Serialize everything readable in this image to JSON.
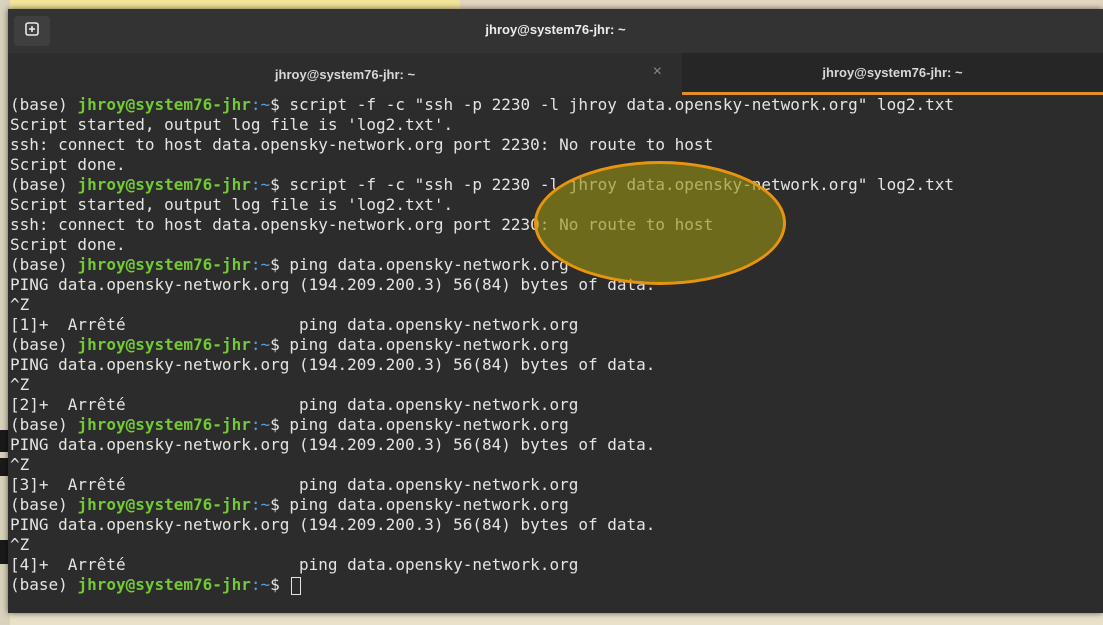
{
  "window": {
    "title": "jhroy@system76-jhr: ~"
  },
  "tabs": [
    {
      "label": "jhroy@system76-jhr: ~",
      "close": "×"
    },
    {
      "label": "jhroy@system76-jhr: ~"
    }
  ],
  "prompt": {
    "env": "(base) ",
    "user_host": "jhroy@system76-jhr",
    "path": ":~",
    "symbol": "$ "
  },
  "terminal_lines": [
    {
      "type": "cmd",
      "text": "script -f -c \"ssh -p 2230 -l jhroy data.opensky-network.org\" log2.txt"
    },
    {
      "type": "out",
      "text": "Script started, output log file is 'log2.txt'."
    },
    {
      "type": "out",
      "text": "ssh: connect to host data.opensky-network.org port 2230: No route to host"
    },
    {
      "type": "out",
      "text": "Script done."
    },
    {
      "type": "cmd",
      "text": "script -f -c \"ssh -p 2230 -l jhroy data.opensky-network.org\" log2.txt"
    },
    {
      "type": "out",
      "text": "Script started, output log file is 'log2.txt'."
    },
    {
      "type": "out",
      "text": "ssh: connect to host data.opensky-network.org port 2230: No route to host"
    },
    {
      "type": "out",
      "text": "Script done."
    },
    {
      "type": "cmd",
      "text": "ping data.opensky-network.org"
    },
    {
      "type": "out",
      "text": "PING data.opensky-network.org (194.209.200.3) 56(84) bytes of data."
    },
    {
      "type": "out",
      "text": "^Z"
    },
    {
      "type": "out",
      "text": "[1]+  Arrêté                  ping data.opensky-network.org"
    },
    {
      "type": "cmd",
      "text": "ping data.opensky-network.org"
    },
    {
      "type": "out",
      "text": "PING data.opensky-network.org (194.209.200.3) 56(84) bytes of data."
    },
    {
      "type": "out",
      "text": "^Z"
    },
    {
      "type": "out",
      "text": "[2]+  Arrêté                  ping data.opensky-network.org"
    },
    {
      "type": "cmd",
      "text": "ping data.opensky-network.org"
    },
    {
      "type": "out",
      "text": "PING data.opensky-network.org (194.209.200.3) 56(84) bytes of data."
    },
    {
      "type": "out",
      "text": "^Z"
    },
    {
      "type": "out",
      "text": "[3]+  Arrêté                  ping data.opensky-network.org"
    },
    {
      "type": "cmd",
      "text": "ping data.opensky-network.org"
    },
    {
      "type": "out",
      "text": "PING data.opensky-network.org (194.209.200.3) 56(84) bytes of data."
    },
    {
      "type": "out",
      "text": "^Z"
    },
    {
      "type": "out",
      "text": "[4]+  Arrêté                  ping data.opensky-network.org"
    },
    {
      "type": "cmd",
      "text": ""
    }
  ],
  "icons": {
    "new_tab": "new-tab-icon"
  },
  "colors": {
    "user_host": "#73c936",
    "path": "#4aa3e8",
    "active_tab_underline": "#e08f2c",
    "annotation_border": "#e8940f"
  }
}
